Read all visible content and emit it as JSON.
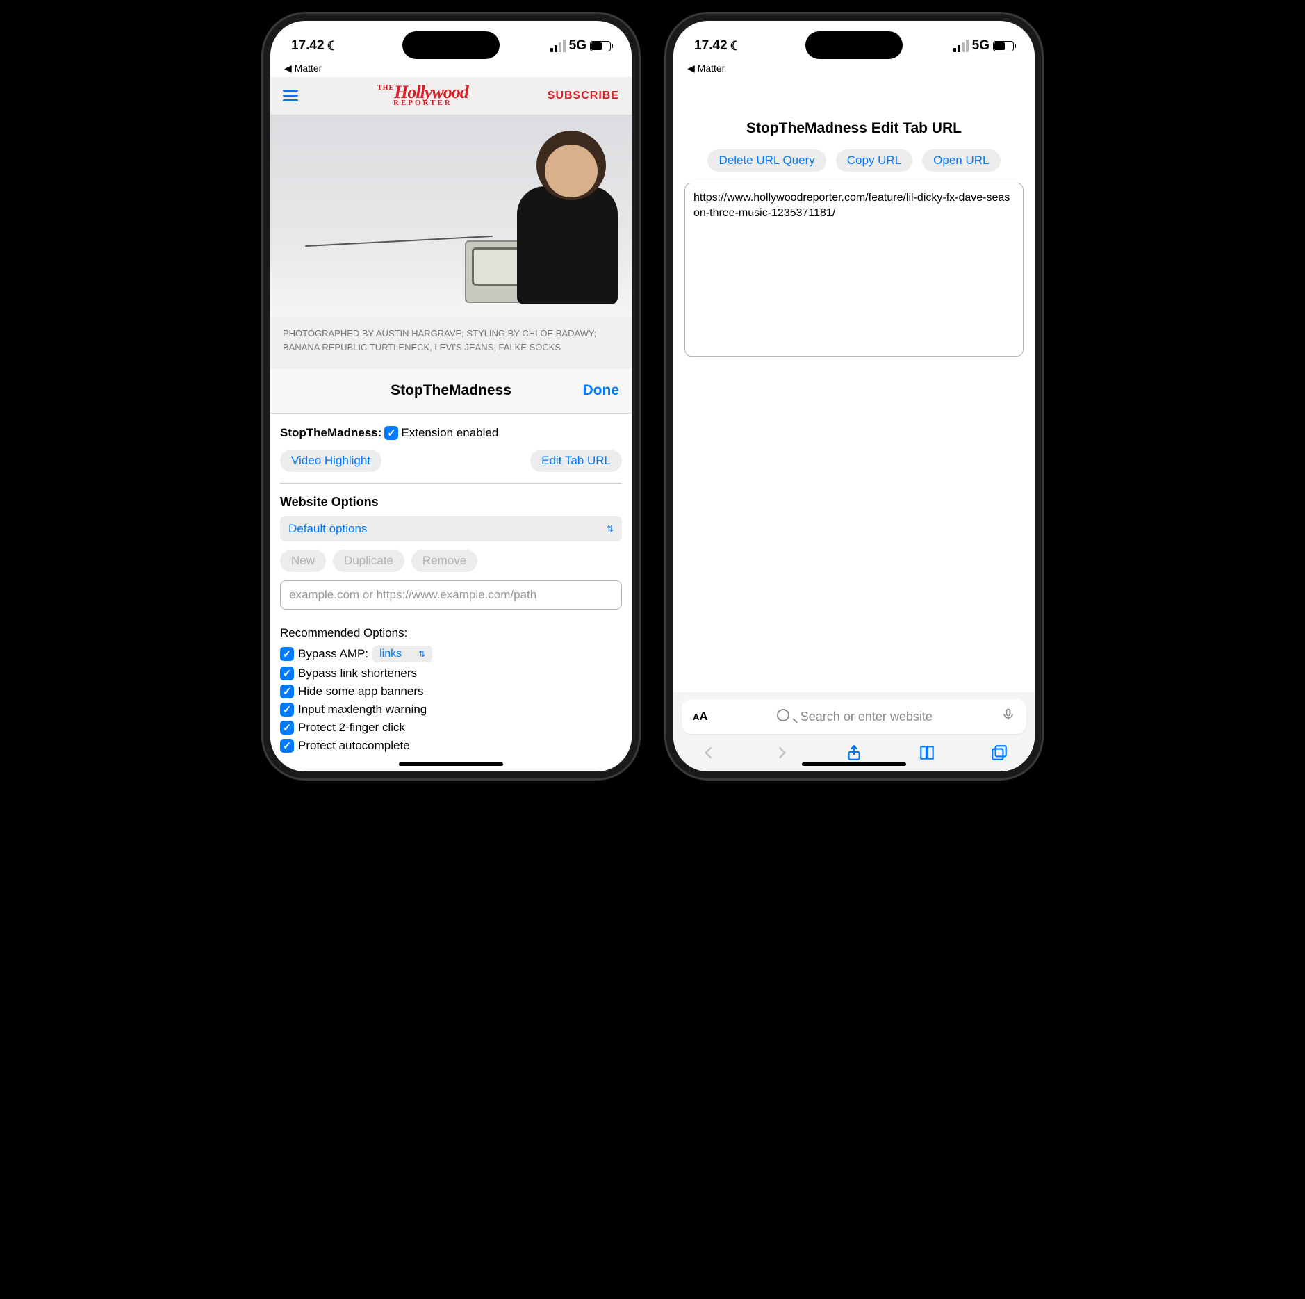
{
  "status": {
    "time": "17.42",
    "breadcrumb": "◀ Matter",
    "network": "5G"
  },
  "left": {
    "header": {
      "logo_top": "Hollywood",
      "logo_sub": "REPORTER",
      "the": "THE",
      "subscribe": "SUBSCRIBE"
    },
    "caption_line1": "PHOTOGRAPHED BY AUSTIN HARGRAVE; STYLING BY CHLOE BADAWY;",
    "caption_line2": "BANANA REPUBLIC TURTLENECK, LEVI'S JEANS, FALKE SOCKS",
    "sheet": {
      "title": "StopTheMadness",
      "done": "Done",
      "ext_label": "StopTheMadness:",
      "ext_enabled": "Extension enabled",
      "btn_video": "Video Highlight",
      "btn_edit_url": "Edit Tab URL",
      "website_options": "Website Options",
      "select_default": "Default options",
      "btn_new": "New",
      "btn_duplicate": "Duplicate",
      "btn_remove": "Remove",
      "url_placeholder": "example.com or https://www.example.com/path",
      "rec_title": "Recommended Options:",
      "opt_amp_label": "Bypass AMP:",
      "opt_amp_select": "links",
      "opt_shorteners": "Bypass link shorteners",
      "opt_banners": "Hide some app banners",
      "opt_maxlength": "Input maxlength warning",
      "opt_2finger": "Protect 2-finger click",
      "opt_autocomplete": "Protect autocomplete"
    }
  },
  "right": {
    "title": "StopTheMadness Edit Tab URL",
    "btn_delete": "Delete URL Query",
    "btn_copy": "Copy URL",
    "btn_open": "Open URL",
    "url": "https://www.hollywoodreporter.com/feature/lil-dicky-fx-dave-season-three-music-1235371181/",
    "search_placeholder": "Search or enter website"
  }
}
